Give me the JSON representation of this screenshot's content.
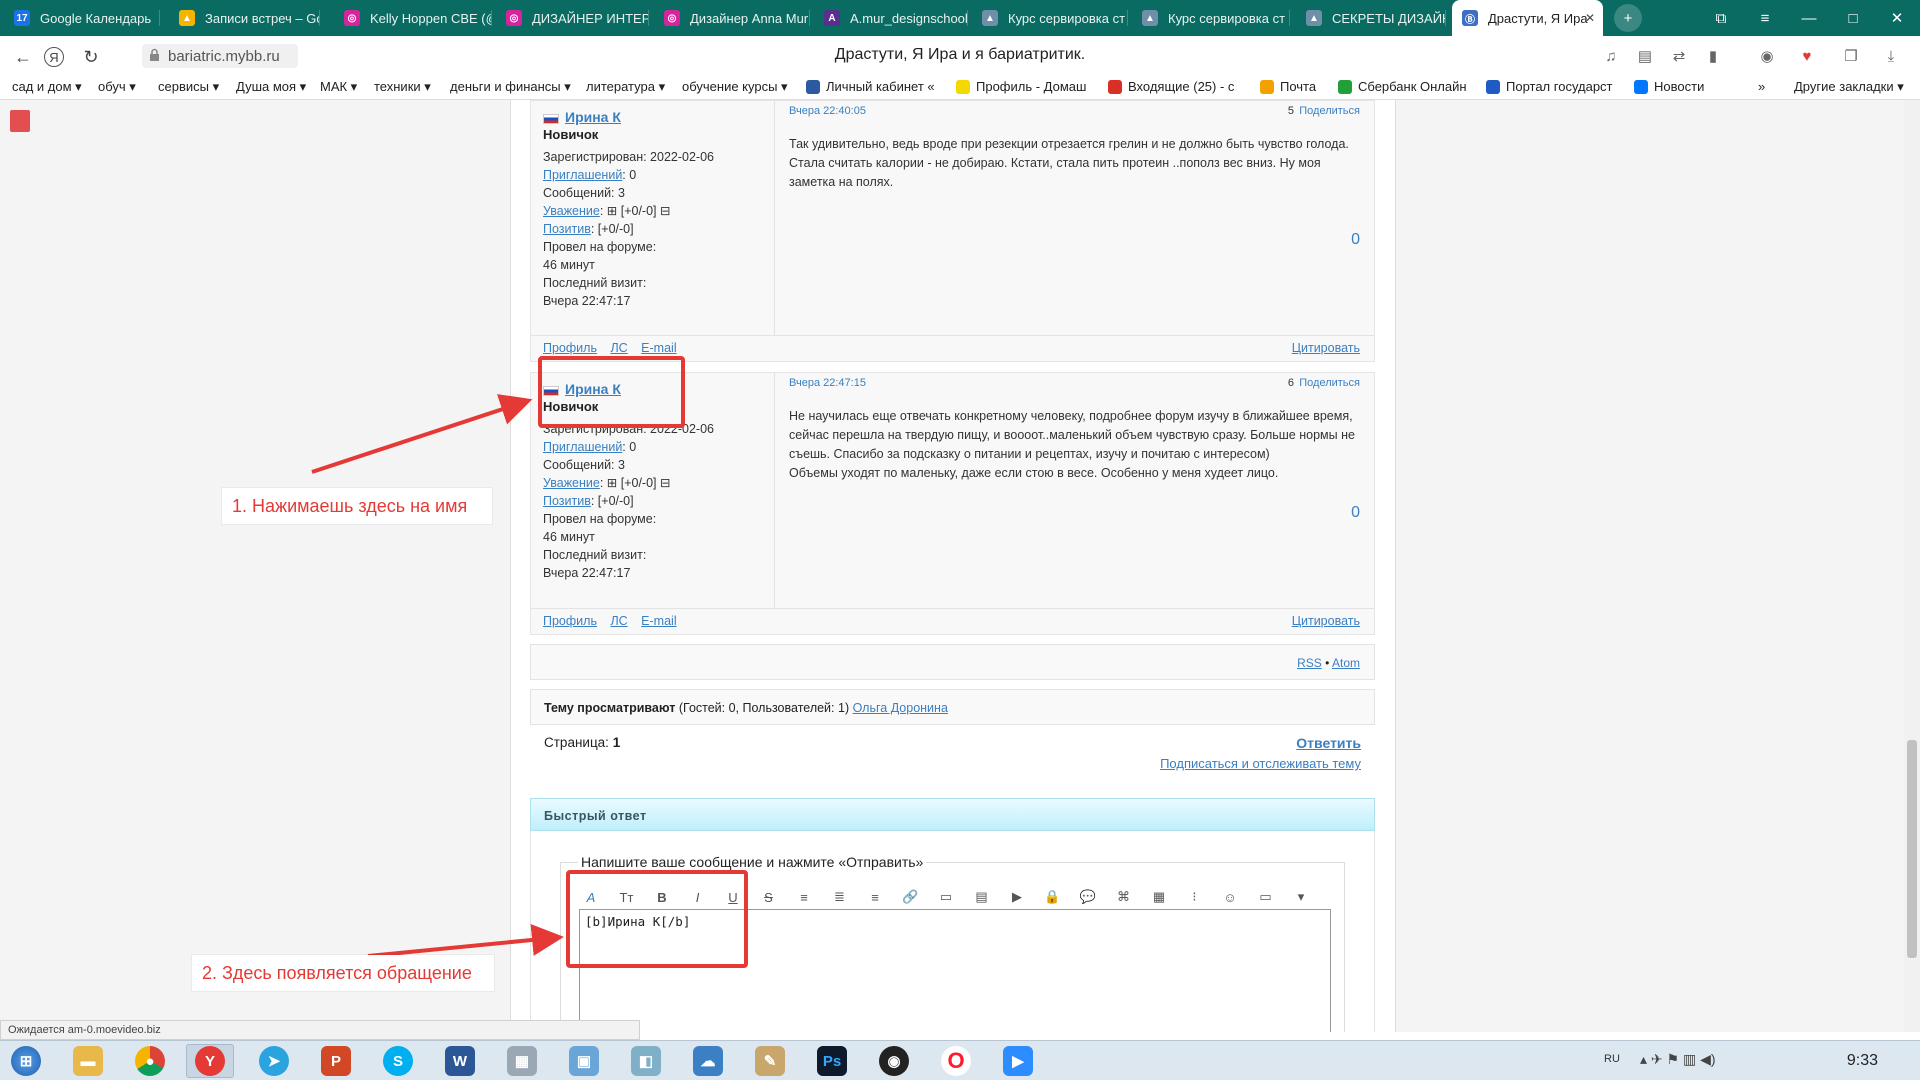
{
  "browser": {
    "tabs": [
      {
        "label": "Google Календарь",
        "color": "#1a73e8",
        "glyph": "17"
      },
      {
        "label": "Записи встреч – Go",
        "color": "#f4b400",
        "glyph": "▲"
      },
      {
        "label": "Kelly Hoppen CBE (@",
        "color": "#d6249f",
        "glyph": "◎"
      },
      {
        "label": "ДИЗАЙНЕР ИНТЕРЬ",
        "color": "#d6249f",
        "glyph": "◎"
      },
      {
        "label": "Дизайнер Anna Mur",
        "color": "#d6249f",
        "glyph": "◎"
      },
      {
        "label": "A.mur_designschool",
        "color": "#5c2d91",
        "glyph": "A"
      },
      {
        "label": "Курс сервировка ст",
        "color": "#6f8fa8",
        "glyph": "▲"
      },
      {
        "label": "Курс сервировка ст",
        "color": "#6f8fa8",
        "glyph": "▲"
      },
      {
        "label": "СЕКРЕТЫ ДИЗАЙН",
        "color": "#6f8fa8",
        "glyph": "▲"
      },
      {
        "label": "Драстути, Я Ира",
        "color": "#3b6fc2",
        "glyph": "Ⓑ"
      }
    ],
    "url": "bariatric.mybb.ru",
    "page_title": "Драстути, Я Ира и я бариатритик.",
    "bookmarks": [
      {
        "label": "сад и дом ▾"
      },
      {
        "label": "обуч ▾"
      },
      {
        "label": "сервисы ▾"
      },
      {
        "label": "Душа моя ▾"
      },
      {
        "label": "МАК ▾"
      },
      {
        "label": "техники ▾"
      },
      {
        "label": "деньги и финансы ▾"
      },
      {
        "label": "литература ▾"
      },
      {
        "label": "обучение курсы ▾"
      },
      {
        "label": "Личный кабинет «",
        "color": "#2c5aa0"
      },
      {
        "label": "Профиль - Домаш",
        "color": "#f5d800"
      },
      {
        "label": "Входящие (25) - с",
        "color": "#d93025"
      },
      {
        "label": "Почта",
        "color": "#f4a100"
      },
      {
        "label": "Сбербанк Онлайн",
        "color": "#21a038"
      },
      {
        "label": "Портал государст",
        "color": "#1f5bc2"
      },
      {
        "label": "Новости",
        "color": "#0077ff"
      },
      {
        "label": "»"
      },
      {
        "label": "Другие закладки ▾"
      }
    ]
  },
  "posts": [
    {
      "author": "Ирина К",
      "rank": "Новичок",
      "registered": "Зарегистрирован: 2022-02-06",
      "invites_label": "Приглашений",
      "invites_value": ": 0",
      "messages": "Сообщений: 3",
      "respect_label": "Уважение",
      "respect_value": ": ⊞ [+0/-0] ⊟",
      "positive_label": "Позитив",
      "positive_value": ": [+0/-0]",
      "time_on_forum_label": "Провел на форуме:",
      "time_on_forum": "46 минут",
      "last_visit_label": "Последний визит:",
      "last_visit": "Вчера 22:47:17",
      "time": "Вчера 22:40:05",
      "number": "5",
      "share": "Поделиться",
      "text": "Так удивительно, ведь вроде при резекции отрезается грелин и не должно быть чувство голода.\nСтала считать калории - не добираю. Кстати, стала пить протеин ..пополз вес вниз. Ну моя заметка на полях.",
      "score": "0",
      "link_profile": "Профиль",
      "link_pm": "ЛС",
      "link_email": "E-mail",
      "quote": "Цитировать"
    },
    {
      "author": "Ирина К",
      "rank": "Новичок",
      "registered": "Зарегистрирован: 2022-02-06",
      "invites_label": "Приглашений",
      "invites_value": ": 0",
      "messages": "Сообщений: 3",
      "respect_label": "Уважение",
      "respect_value": ": ⊞ [+0/-0] ⊟",
      "positive_label": "Позитив",
      "positive_value": ": [+0/-0]",
      "time_on_forum_label": "Провел на форуме:",
      "time_on_forum": "46 минут",
      "last_visit_label": "Последний визит:",
      "last_visit": "Вчера 22:47:17",
      "time": "Вчера 22:47:15",
      "number": "6",
      "share": "Поделиться",
      "text": "Не научилась еще отвечать конкретному человеку, подробнее форум изучу в ближайшее время, сейчас  перешла на твердую пищу,  и воооот..маленький объем чувствую сразу.  Больше нормы не съешь. Спасибо за подсказку о питании и рецептах,  изучу и почитаю с интересом)\nОбъемы уходят по маленьку, даже если стою  в весе. Особенно у меня худеет лицо.",
      "score": "0",
      "link_profile": "Профиль",
      "link_pm": "ЛС",
      "link_email": "E-mail",
      "quote": "Цитировать"
    }
  ],
  "feeds": {
    "rss": "RSS",
    "bullet": "•",
    "atom": "Atom"
  },
  "viewers": {
    "label": "Тему просматривают",
    "text": "(Гостей: 0, Пользователей: 1)",
    "user": "Ольга Доронина"
  },
  "pagination": {
    "label": "Страница:",
    "current": "1"
  },
  "actions": {
    "reply": "Ответить",
    "subscribe": "Подписаться и отслеживать тему"
  },
  "quick_reply": {
    "header": "Быстрый ответ",
    "legend": "Напишите ваше сообщение и нажмите «Отправить»",
    "text": "[b]Ирина К[/b]"
  },
  "toolbar_icons": [
    "font-icon",
    "size-icon",
    "bold-icon",
    "italic-icon",
    "underline-icon",
    "strike-icon",
    "align-left-icon",
    "align-center-icon",
    "align-right-icon",
    "link-icon",
    "image-icon",
    "gallery-icon",
    "video-icon",
    "hide-icon",
    "quote-icon",
    "code-icon",
    "table-icon",
    "list-icon",
    "smile-icon",
    "spoiler-icon",
    "more-icon"
  ],
  "annotations": {
    "step1": "1. Нажимаешь здесь на имя",
    "step2": "2. Здесь появляется обращение"
  },
  "status_text": "Ожидается am-0.moevideo.biz",
  "tray": {
    "lang": "RU",
    "time": "9:33"
  },
  "colors": {
    "annotation": "#e53935",
    "link": "#3a7fc2",
    "tabbar": "#096b62"
  }
}
